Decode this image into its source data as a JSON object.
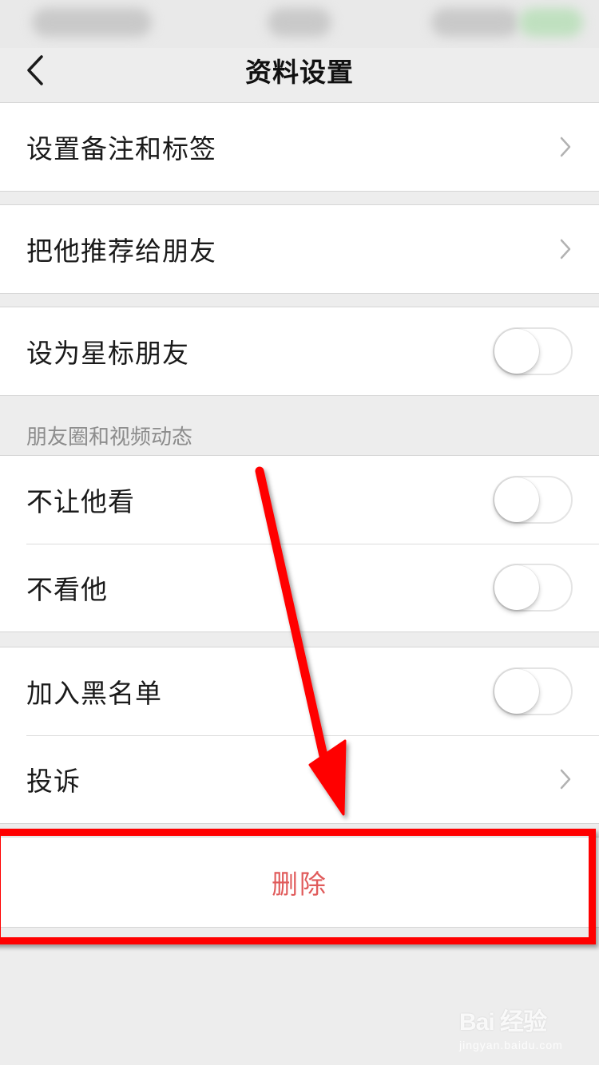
{
  "header": {
    "title": "资料设置",
    "back_icon": "chevron-left-icon"
  },
  "groups": [
    {
      "items": [
        {
          "label": "设置备注和标签",
          "accessory": "chevron"
        }
      ]
    },
    {
      "items": [
        {
          "label": "把他推荐给朋友",
          "accessory": "chevron"
        }
      ]
    },
    {
      "items": [
        {
          "label": "设为星标朋友",
          "accessory": "switch",
          "on": false
        }
      ]
    },
    {
      "items": [
        {
          "label": "不让他看",
          "accessory": "switch",
          "on": false
        },
        {
          "label": "不看他",
          "accessory": "switch",
          "on": false
        }
      ]
    },
    {
      "items": [
        {
          "label": "加入黑名单",
          "accessory": "switch",
          "on": false
        },
        {
          "label": "投诉",
          "accessory": "chevron"
        }
      ]
    }
  ],
  "section_header": "朋友圈和视频动态",
  "delete": {
    "label": "删除",
    "color": "#e05a5a"
  },
  "annotation": {
    "color": "#ff0000"
  },
  "watermark": {
    "logo": "Bai 经验",
    "url": "jingyan.baidu.com"
  }
}
